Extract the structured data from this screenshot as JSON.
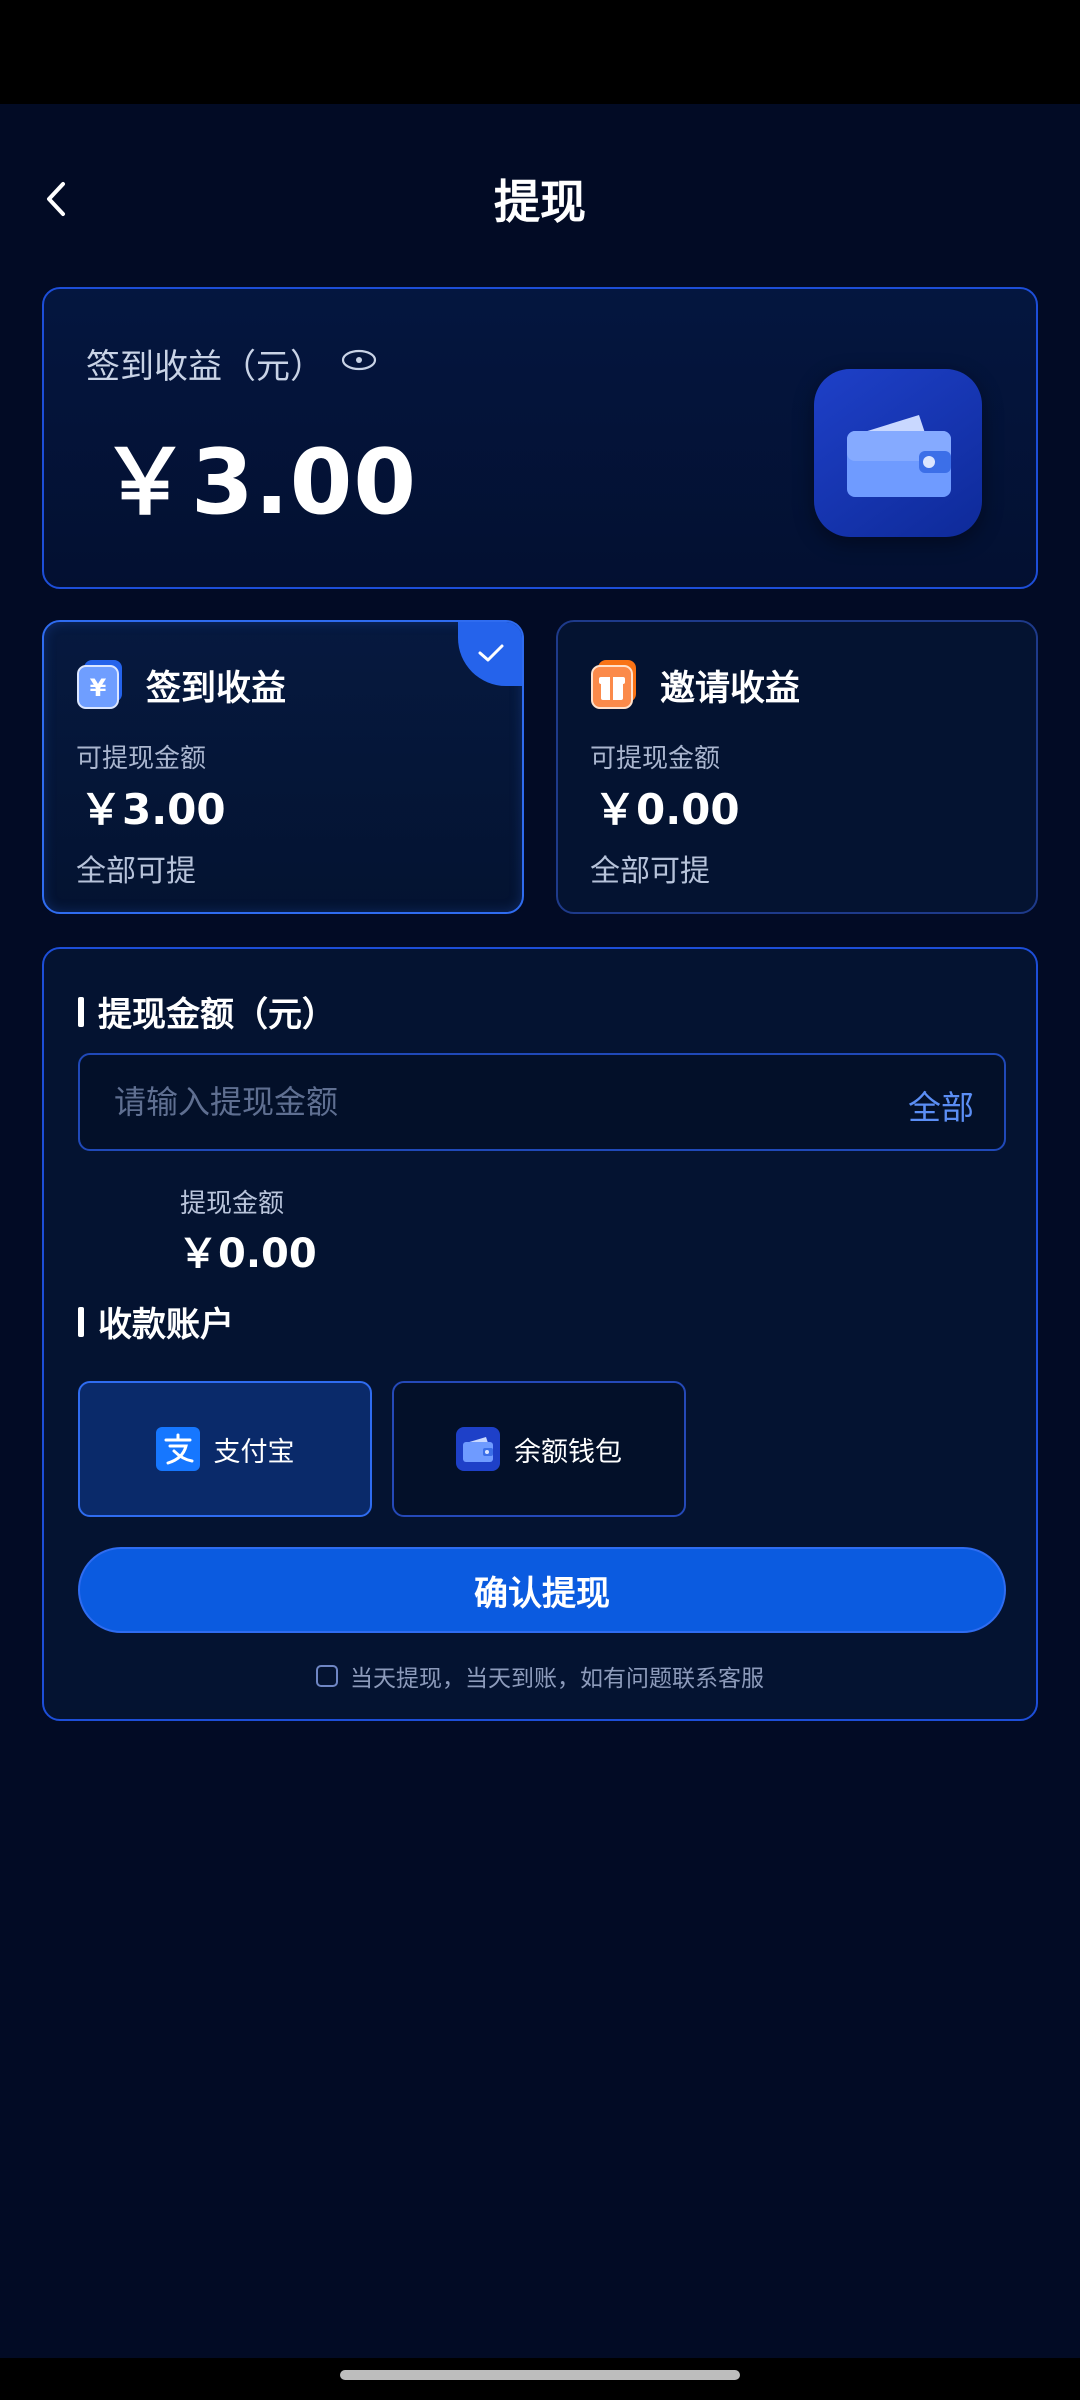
{
  "header": {
    "title": "提现"
  },
  "balance": {
    "label": "签到收益（元）",
    "amount": "￥3.00"
  },
  "income_cards": [
    {
      "title": "签到收益",
      "withdrawable_label": "可提现金额",
      "amount": "￥3.00",
      "all_label": "全部可提",
      "selected": true
    },
    {
      "title": "邀请收益",
      "withdrawable_label": "可提现金额",
      "amount": "￥0.00",
      "all_label": "全部可提",
      "selected": false
    }
  ],
  "withdraw": {
    "section_title": "提现金额（元）",
    "input_placeholder": "请输入提现金额",
    "input_value": "",
    "all_button": "全部",
    "preview_label": "提现金额",
    "preview_amount": "￥0.00"
  },
  "account": {
    "section_title": "收款账户",
    "options": [
      {
        "label": "支付宝",
        "icon": "alipay-icon",
        "selected": true
      },
      {
        "label": "余额钱包",
        "icon": "wallet-icon",
        "selected": false
      }
    ]
  },
  "confirm_button": "确认提现",
  "notice": "当天提现，当天到账，如有问题联系客服",
  "colors": {
    "background": "#020b25",
    "accent": "#0b5be0",
    "border": "#1d4ed8",
    "link": "#5b8ef5"
  }
}
